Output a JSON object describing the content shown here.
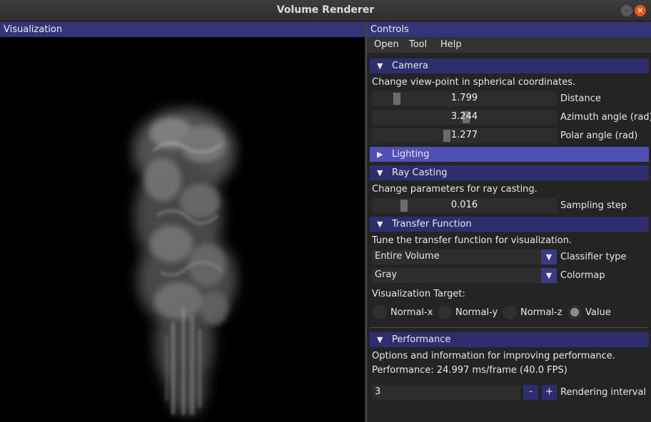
{
  "window": {
    "title": "Volume Renderer"
  },
  "visualization": {
    "title": "Visualization"
  },
  "controls": {
    "title": "Controls",
    "menu": [
      "Open",
      "Tool",
      "Help"
    ],
    "camera": {
      "header": "Camera",
      "description": "Change view-point in spherical coordinates.",
      "distance": {
        "value": "1.799",
        "label": "Distance",
        "level": 0.12
      },
      "azimuth": {
        "value": "3.244",
        "label": "Azimuth angle (rad)",
        "level": 0.51
      },
      "polar": {
        "value": "1.277",
        "label": "Polar angle (rad)",
        "level": 0.4
      }
    },
    "lighting": {
      "header": "Lighting"
    },
    "ray_casting": {
      "header": "Ray Casting",
      "description": "Change parameters for ray casting.",
      "sampling_step": {
        "value": "0.016",
        "label": "Sampling step",
        "level": 0.16
      }
    },
    "transfer_function": {
      "header": "Transfer Function",
      "description": "Tune the transfer function for visualization.",
      "classifier": {
        "value": "Entire Volume",
        "label": "Classifier type"
      },
      "colormap": {
        "value": "Gray",
        "label": "Colormap"
      },
      "target_label": "Visualization Target:",
      "targets": [
        "Normal-x",
        "Normal-y",
        "Normal-z",
        "Value"
      ],
      "selected_target": "Value"
    },
    "performance": {
      "header": "Performance",
      "description": "Options and information for improving performance.",
      "stats": "Performance: 24.997 ms/frame (40.0 FPS)",
      "interval": {
        "value": "3",
        "label": "Rendering interval",
        "minus": "-",
        "plus": "+"
      }
    }
  },
  "colors": {
    "header": "#34347a",
    "section": "#2e2e6e",
    "section_hover": "#5050b4",
    "close_button": "#e95420"
  }
}
